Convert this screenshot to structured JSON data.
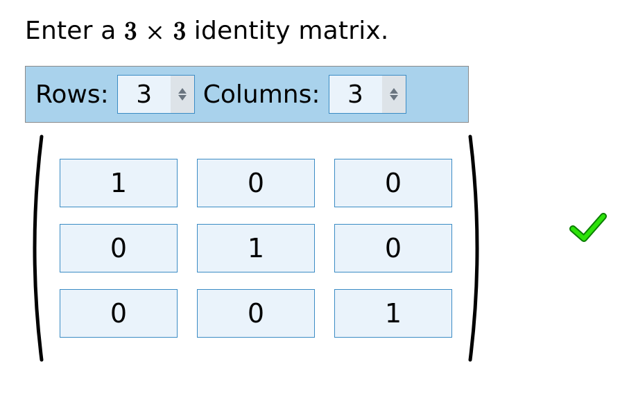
{
  "prompt": {
    "prefix": "Enter a ",
    "math": "3 × 3",
    "suffix": " identity matrix."
  },
  "size_bar": {
    "rows_label": "Rows:",
    "rows_value": "3",
    "cols_label": "Columns:",
    "cols_value": "3"
  },
  "matrix": {
    "rows": 3,
    "cols": 3,
    "cells": [
      [
        "1",
        "0",
        "0"
      ],
      [
        "0",
        "1",
        "0"
      ],
      [
        "0",
        "0",
        "1"
      ]
    ]
  },
  "feedback": {
    "icon_name": "check-icon",
    "correct": true
  }
}
